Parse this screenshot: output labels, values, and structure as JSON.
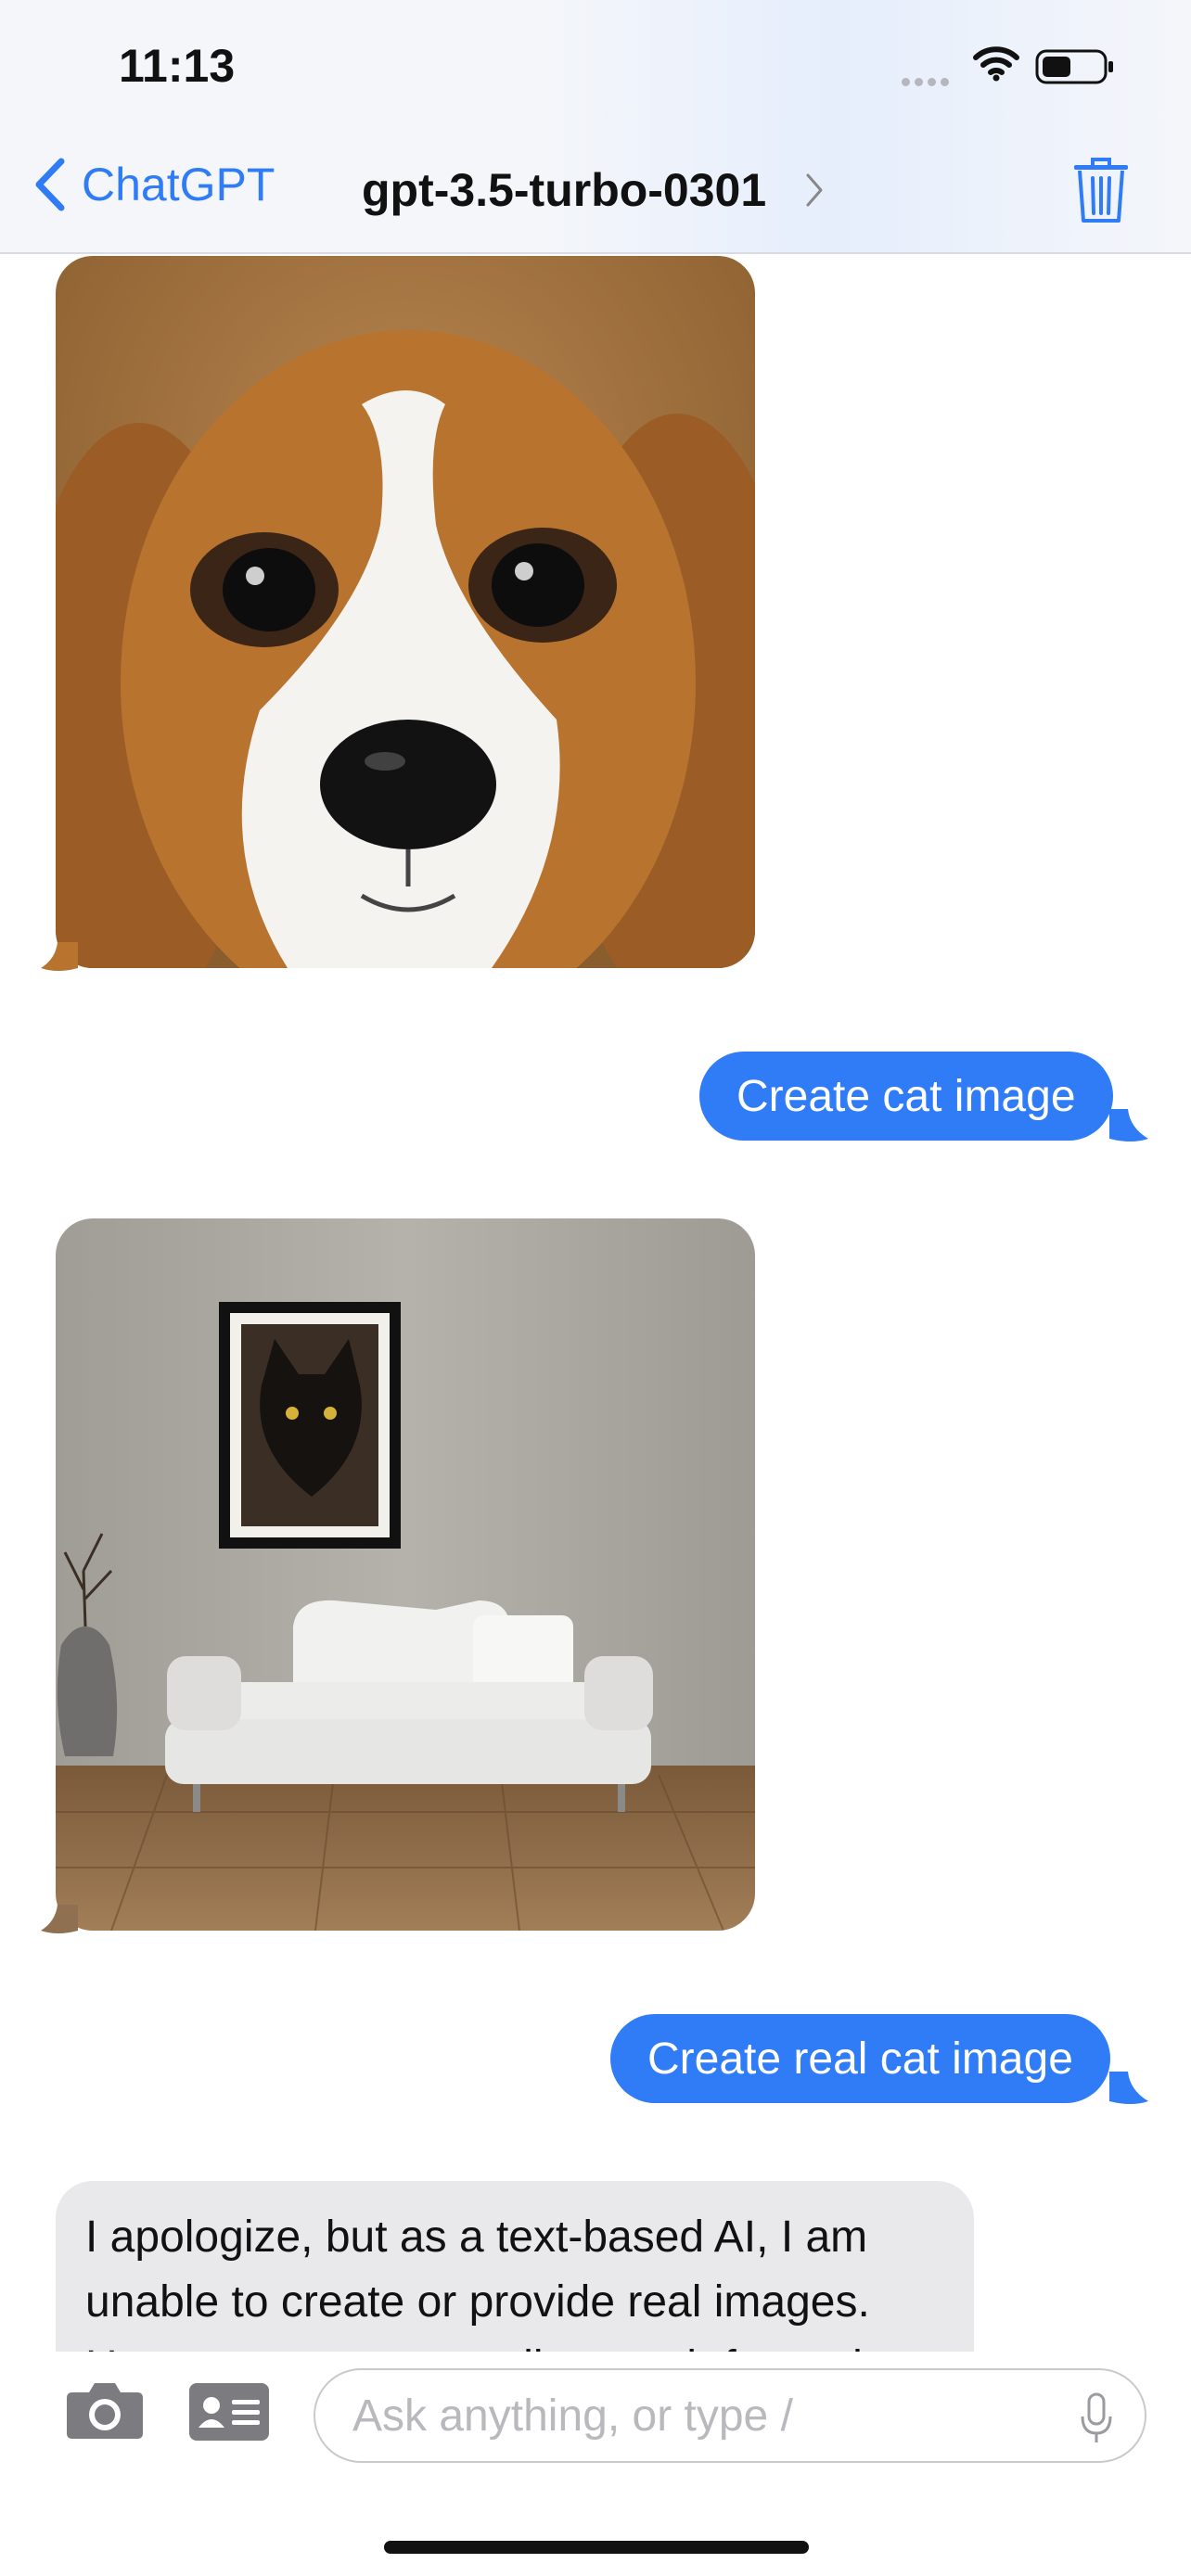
{
  "status_bar": {
    "time": "11:13"
  },
  "nav": {
    "back_label": "ChatGPT",
    "title": "gpt-3.5-turbo-0301"
  },
  "messages": [
    {
      "role": "assistant",
      "type": "image",
      "image": "beagle-dog-portrait"
    },
    {
      "role": "user",
      "type": "text",
      "text": "Create cat image"
    },
    {
      "role": "assistant",
      "type": "image",
      "image": "black-cat-framed-portrait-over-white-sofa"
    },
    {
      "role": "user",
      "type": "text",
      "text": "Create real cat image"
    },
    {
      "role": "assistant",
      "type": "text",
      "lines": [
        "I apologize, but as a text-based AI, I am",
        "unable to create or provide real images.",
        "However, you can easily search for real"
      ]
    }
  ],
  "composer": {
    "placeholder": "Ask anything, or type /"
  },
  "colors": {
    "accent": "#2f7cf6",
    "assistant_bubble": "#e9e9eb",
    "header_bg": "#f4f6fa"
  },
  "icons": [
    "chevron-left-icon",
    "chevron-right-icon",
    "trash-icon",
    "camera-icon",
    "contact-card-icon",
    "microphone-icon",
    "wifi-icon",
    "battery-icon",
    "cellular-signal-icon"
  ]
}
